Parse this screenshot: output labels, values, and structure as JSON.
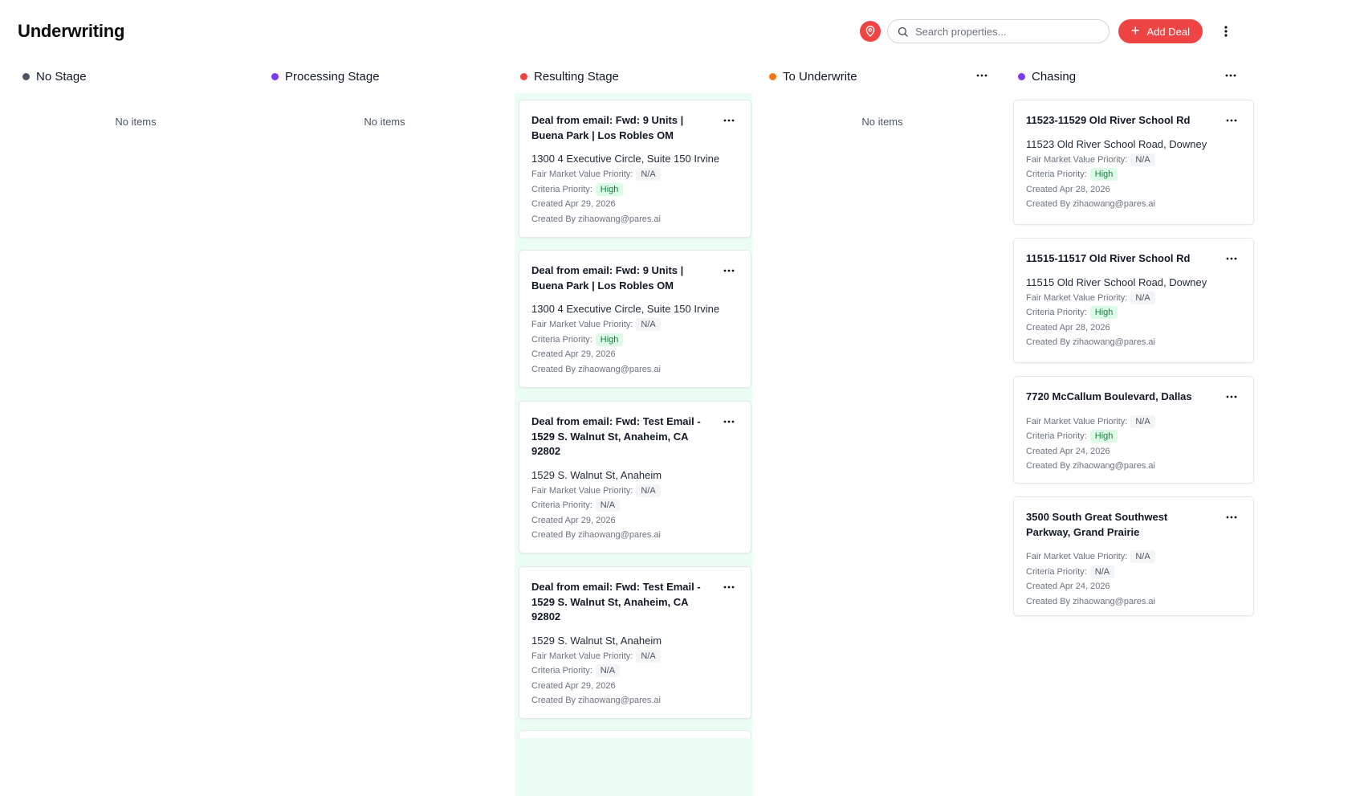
{
  "header": {
    "title": "Underwriting",
    "search_placeholder": "Search properties...",
    "add_deal_label": "Add Deal",
    "add_icon": "+"
  },
  "colors": {
    "accent": "#ef4444",
    "no_stage": "#4b5563",
    "processing_stage": "#7c3aed",
    "resulting_stage": "#ef4444",
    "to_underwrite": "#f97316",
    "chasing": "#7c3aed",
    "high_badge_bg": "#dcfce7",
    "high_badge_text": "#15803d",
    "lane_bg": "#ecfdf3"
  },
  "columns": {
    "no_stage": {
      "title": "No Stage",
      "empty": "No items"
    },
    "processing": {
      "title": "Processing Stage",
      "empty": "No items"
    },
    "resulting": {
      "title": "Resulting Stage",
      "cards": [
        {
          "title": "Deal from email: Fwd: 9 Units | Buena Park | Los Robles OM",
          "address": "1300 4 Executive Circle, Suite 150 Irvine",
          "fmv_label": "Fair Market Value Priority:",
          "fmv": "N/A",
          "criteria_label": "Criteria Priority:",
          "criteria": "High",
          "created": "Created Apr 29, 2026",
          "created_by": "Created By zihaowang@pares.ai"
        },
        {
          "title": "Deal from email: Fwd: 9 Units | Buena Park | Los Robles OM",
          "address": "1300 4 Executive Circle, Suite 150 Irvine",
          "fmv_label": "Fair Market Value Priority:",
          "fmv": "N/A",
          "criteria_label": "Criteria Priority:",
          "criteria": "High",
          "created": "Created Apr 29, 2026",
          "created_by": "Created By zihaowang@pares.ai"
        },
        {
          "title": "Deal from email: Fwd: Test Email - 1529 S. Walnut St, Anaheim, CA 92802",
          "address": "1529 S. Walnut St, Anaheim",
          "fmv_label": "Fair Market Value Priority:",
          "fmv": "N/A",
          "criteria_label": "Criteria Priority:",
          "criteria": "N/A",
          "created": "Created Apr 29, 2026",
          "created_by": "Created By zihaowang@pares.ai"
        },
        {
          "title": "Deal from email: Fwd: Test Email - 1529 S. Walnut St, Anaheim, CA 92802",
          "address": "1529 S. Walnut St, Anaheim",
          "fmv_label": "Fair Market Value Priority:",
          "fmv": "N/A",
          "criteria_label": "Criteria Priority:",
          "criteria": "N/A",
          "created": "Created Apr 29, 2026",
          "created_by": "Created By zihaowang@pares.ai"
        }
      ]
    },
    "to_underwrite": {
      "title": "To Underwrite",
      "empty": "No items"
    },
    "chasing": {
      "title": "Chasing",
      "cards": [
        {
          "title": "11523-11529 Old River School Rd",
          "address": "11523 Old River School Road, Downey",
          "fmv_label": "Fair Market Value Priority:",
          "fmv": "N/A",
          "criteria_label": "Criteria Priority:",
          "criteria": "High",
          "created": "Created Apr 28, 2026",
          "created_by": "Created By zihaowang@pares.ai"
        },
        {
          "title": "11515-11517 Old River School Rd",
          "address": "11515 Old River School Road, Downey",
          "fmv_label": "Fair Market Value Priority:",
          "fmv": "N/A",
          "criteria_label": "Criteria Priority:",
          "criteria": "High",
          "created": "Created Apr 28, 2026",
          "created_by": "Created By zihaowang@pares.ai"
        },
        {
          "title": "7720 McCallum Boulevard, Dallas",
          "fmv_label": "Fair Market Value Priority:",
          "fmv": "N/A",
          "criteria_label": "Criteria Priority:",
          "criteria": "High",
          "created": "Created Apr 24, 2026",
          "created_by": "Created By zihaowang@pares.ai"
        },
        {
          "title": "3500 South Great Southwest Parkway, Grand Prairie",
          "fmv_label": "Fair Market Value Priority:",
          "fmv": "N/A",
          "criteria_label": "Criteria Priority:",
          "criteria": "N/A",
          "created": "Created Apr 24, 2026",
          "created_by": "Created By zihaowang@pares.ai"
        }
      ]
    }
  }
}
